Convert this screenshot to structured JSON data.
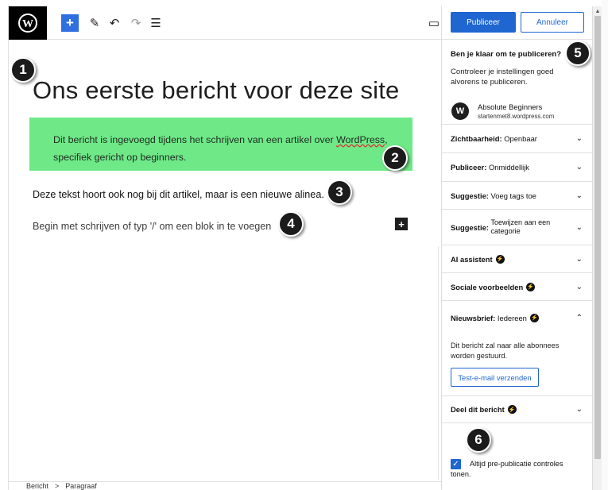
{
  "toolbar": {
    "logo_icon": "wordpress-logo-icon",
    "add_label": "+",
    "edit_glyph": "✎",
    "undo_glyph": "↶",
    "redo_glyph": "↷",
    "outline_glyph": "☰",
    "preview_glyph": "▭"
  },
  "editor": {
    "title": "Ons eerste bericht voor deze site",
    "block1_text_a": "Dit bericht is ingevoegd tijdens het schrijven van een artikel over ",
    "block1_link": "WordPress",
    "block1_text_b": ", specifiek gericht op beginners.",
    "block1_bg": "#6fe888",
    "block2_text": "Deze tekst hoort ook nog bij dit artikel, maar is een nieuwe alinea.",
    "placeholder_text": "Begin met schrijven of typ '/' om een blok in te voegen",
    "inline_add": "+"
  },
  "breadcrumb": {
    "items": [
      "Bericht",
      "Paragraaf"
    ],
    "separator": ">"
  },
  "badges": [
    "1",
    "2",
    "3",
    "4",
    "5",
    "6"
  ],
  "sidebar": {
    "publish_label": "Publiceer",
    "cancel_label": "Annuleer",
    "ready_title": "Ben je klaar om te publiceren?",
    "ready_desc": "Controleer je instellingen goed alvorens te publiceren.",
    "site_logo": "W",
    "site_name": "Absolute Beginners",
    "site_url": "startenmet8.wordpress.com",
    "panels": [
      {
        "label": "Zichtbaarheid:",
        "value": "Openbaar",
        "expanded": false
      },
      {
        "label": "Publiceer:",
        "value": "Onmiddellijk",
        "expanded": false
      },
      {
        "label": "Suggestie:",
        "value": "Voeg tags toe",
        "expanded": false
      },
      {
        "label": "Suggestie:",
        "value": "Toewijzen aan een categorie",
        "expanded": false
      },
      {
        "label": "AI assistent",
        "value": "",
        "expanded": false
      },
      {
        "label": "Sociale voorbeelden",
        "value": "",
        "expanded": false
      },
      {
        "label": "Nieuwsbrief:",
        "value": "Iedereen",
        "expanded": true
      },
      {
        "label": "Deel dit bericht",
        "value": "",
        "expanded": false
      }
    ],
    "newsletter_desc": "Dit bericht zal naar alle abonnees worden gestuurd.",
    "test_email_label": "Test-e-mail verzenden",
    "prepub_label": "Altijd pre-publicatie controles",
    "prepub_label_2": "tonen.",
    "prepub_checked": true
  },
  "colors": {
    "accent": "#1f66d0",
    "badge": "#1b1b1b"
  }
}
